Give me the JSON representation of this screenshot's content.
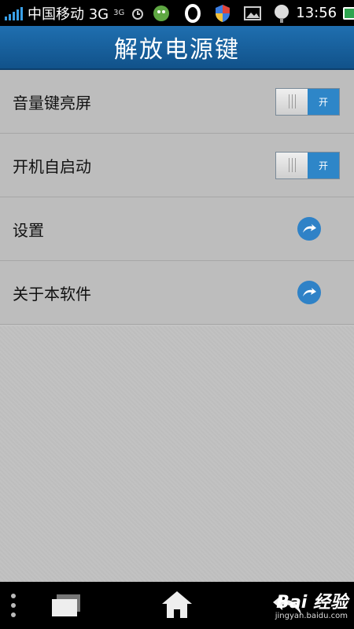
{
  "status_bar": {
    "carrier": "中国移动 3G",
    "network_small": "3G",
    "time": "13:56"
  },
  "header": {
    "title": "解放电源键"
  },
  "settings": {
    "items": [
      {
        "label": "音量键亮屏",
        "control": "toggle",
        "state": "开"
      },
      {
        "label": "开机自启动",
        "control": "toggle",
        "state": "开"
      },
      {
        "label": "设置",
        "control": "arrow"
      },
      {
        "label": "关于本软件",
        "control": "arrow"
      }
    ]
  },
  "colors": {
    "header": "#1f6fb0",
    "toggle_on": "#2e86c8",
    "arrow_button": "#2f82c7",
    "battery": "#2ea44f",
    "signal": "#3aa0e8"
  },
  "icons": {
    "status": [
      "signal-icon",
      "alarm-icon",
      "app-icon",
      "o-icon",
      "shield-icon",
      "image-icon",
      "notification-icon",
      "battery-icon"
    ],
    "nav": [
      "menu-icon",
      "recent-apps-icon",
      "home-icon",
      "back-icon"
    ]
  },
  "watermark": {
    "main": "Bai 经验",
    "sub": "jingyan.baidu.com"
  }
}
